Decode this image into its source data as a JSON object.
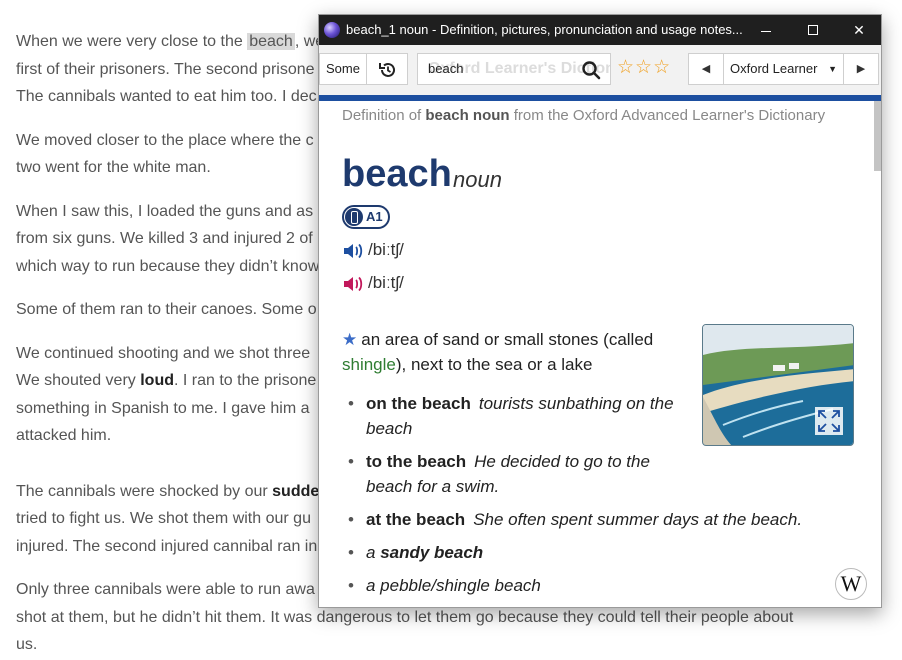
{
  "background_text": {
    "lines": [
      "When we were very close to the",
      "beach",
      ", we",
      "first of their prisoners. The second prisone",
      "The cannibals wanted to eat him too. I dec",
      "We moved closer to the place where the c",
      "two went for the white man.",
      "When I saw this, I loaded the guns and as",
      "from six guns. We killed 3 and injured 2 of",
      "which way to run because they didn’t know",
      "Some of them ran to their canoes. Some o",
      "We continued shooting and we shot three",
      "We shouted very",
      "loud",
      ". I ran to the prisone",
      "something in Spanish to me. I gave him a",
      "attacked him.",
      "The cannibals were shocked by our",
      "sudde",
      "tried to fight us. We shot them with our gu",
      "injured. The second injured cannibal ran in",
      "Only three cannibals were able to run awa",
      "shot at them, but he didn’t hit them. It was dangerous to let them go because they could tell their people about",
      "us."
    ]
  },
  "window": {
    "title": "beach_1 noun - Definition, pictures, pronunciation and usage notes...",
    "minimize": "minimize",
    "maximize": "maximize",
    "close": "✕"
  },
  "toolbar": {
    "some_label": "Some",
    "search_value": "beach",
    "search_watermark": "Oxford Learner's Dictionaries",
    "stars": "☆☆☆",
    "prev": "◀",
    "dictionary": "Oxford Learner",
    "next": "▶"
  },
  "entry": {
    "subtitle_pre": "Definition of ",
    "subtitle_word": "beach noun",
    "subtitle_post": " from the Oxford Advanced Learner's Dictionary",
    "headword": "beach",
    "pos": "noun",
    "level": "A1",
    "pron_uk": "/biːtʃ/",
    "pron_us": "/biːtʃ/",
    "definition_pre": "an area of sand or small stones (called ",
    "definition_xref": "shingle",
    "definition_post": "), next to the sea or a lake",
    "examples": [
      {
        "collocation": "on the beach",
        "example": "tourists sunbathing on the beach"
      },
      {
        "collocation": "to the beach",
        "example": "He decided to go to the beach for a swim."
      },
      {
        "collocation": "at the beach",
        "example": "She often spent summer days at the beach."
      },
      {
        "pre": "a ",
        "bold_example": "sandy beach"
      },
      {
        "example": "a pebble/shingle beach"
      }
    ],
    "wiki_glyph": "W"
  },
  "colors": {
    "headword": "#1e3a6e",
    "accent_bar": "#1d4fa0",
    "xref": "#2f7d32",
    "stars": "#f0a020",
    "uk_speaker": "#1d4fa0",
    "us_speaker": "#c2185b"
  },
  "icons": [
    "app-icon",
    "history-icon",
    "search-icon",
    "uk-speaker-icon",
    "us-speaker-icon",
    "star-icon",
    "expand-icon",
    "wikipedia-icon"
  ]
}
